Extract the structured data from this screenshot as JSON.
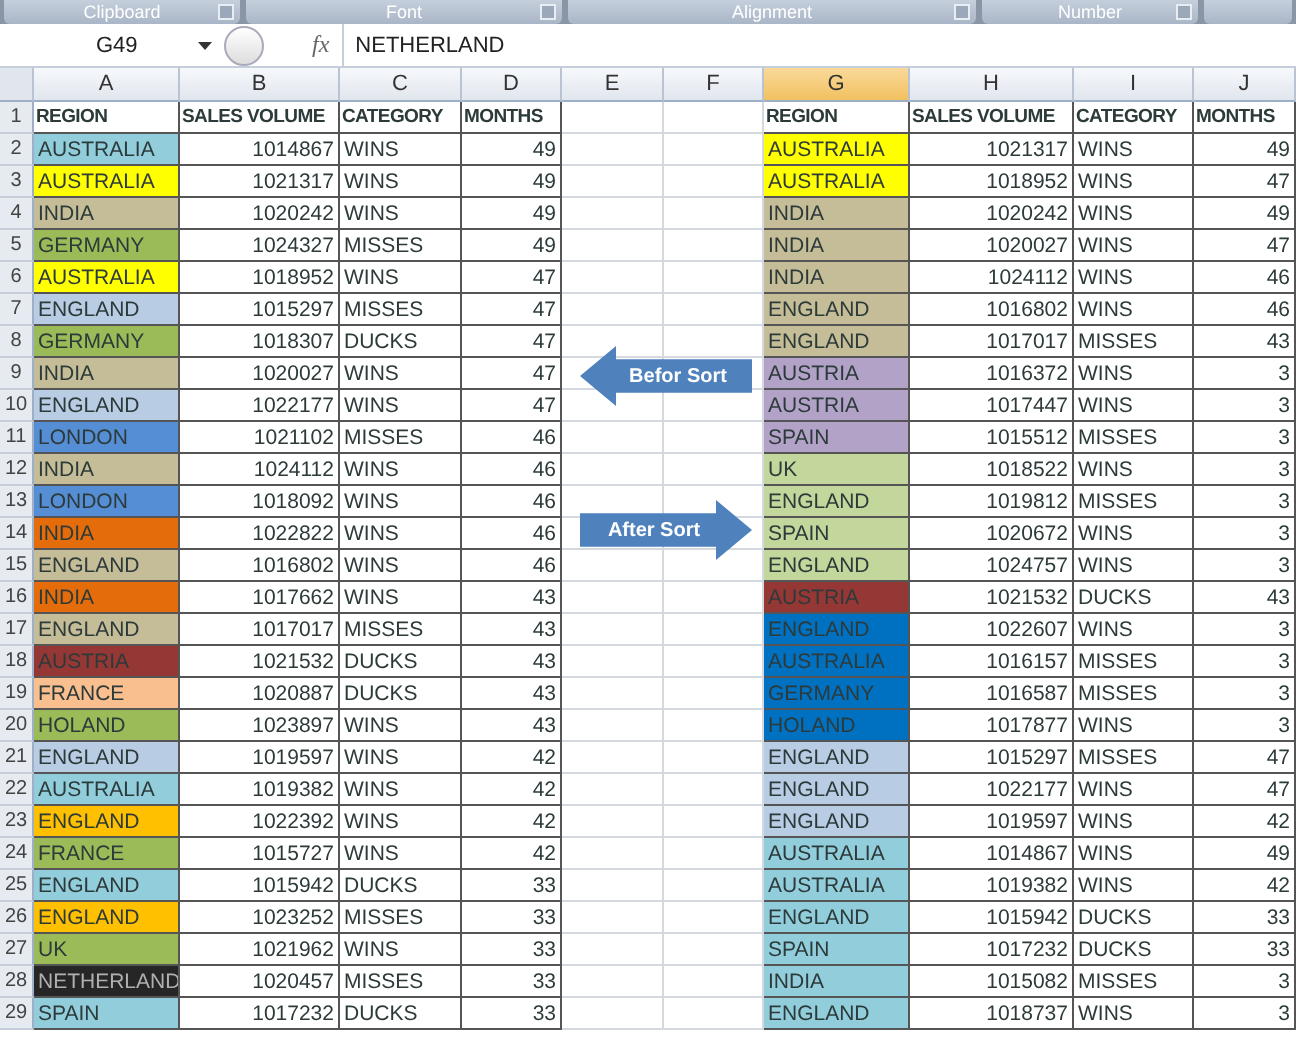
{
  "ribbon_groups": [
    {
      "label": "Clipboard"
    },
    {
      "label": "Font"
    },
    {
      "label": "Alignment"
    },
    {
      "label": "Number"
    }
  ],
  "formula_bar": {
    "name_box": "G49",
    "function_label": "fx",
    "formula": "NETHERLAND"
  },
  "columns": [
    {
      "label": "A",
      "selected": false
    },
    {
      "label": "B",
      "selected": false
    },
    {
      "label": "C",
      "selected": false
    },
    {
      "label": "D",
      "selected": false
    },
    {
      "label": "E",
      "selected": false
    },
    {
      "label": "F",
      "selected": false
    },
    {
      "label": "G",
      "selected": true
    },
    {
      "label": "H",
      "selected": false
    },
    {
      "label": "I",
      "selected": false
    },
    {
      "label": "J",
      "selected": false
    }
  ],
  "header_row": {
    "number": "1",
    "left": [
      "REGION",
      "SALES VOLUME",
      "CATEGORY",
      "MONTHS"
    ],
    "right": [
      "REGION",
      "SALES VOLUME",
      "CATEGORY",
      "MONTHS"
    ]
  },
  "rows": [
    {
      "number": "2",
      "left": {
        "region": "AUSTRALIA",
        "color": "#92cddc",
        "sales": "1014867",
        "category": "WINS",
        "months": "49"
      },
      "right": {
        "region": "AUSTRALIA",
        "color": "#ffff00",
        "sales": "1021317",
        "category": "WINS",
        "months": "49"
      }
    },
    {
      "number": "3",
      "left": {
        "region": "AUSTRALIA",
        "color": "#ffff00",
        "sales": "1021317",
        "category": "WINS",
        "months": "49"
      },
      "right": {
        "region": "AUSTRALIA",
        "color": "#ffff00",
        "sales": "1018952",
        "category": "WINS",
        "months": "47"
      }
    },
    {
      "number": "4",
      "left": {
        "region": "INDIA",
        "color": "#c4bd97",
        "sales": "1020242",
        "category": "WINS",
        "months": "49"
      },
      "right": {
        "region": "INDIA",
        "color": "#c4bd97",
        "sales": "1020242",
        "category": "WINS",
        "months": "49"
      }
    },
    {
      "number": "5",
      "left": {
        "region": "GERMANY",
        "color": "#9bbb59",
        "sales": "1024327",
        "category": "MISSES",
        "months": "49"
      },
      "right": {
        "region": "INDIA",
        "color": "#c4bd97",
        "sales": "1020027",
        "category": "WINS",
        "months": "47"
      }
    },
    {
      "number": "6",
      "left": {
        "region": "AUSTRALIA",
        "color": "#ffff00",
        "sales": "1018952",
        "category": "WINS",
        "months": "47"
      },
      "right": {
        "region": "INDIA",
        "color": "#c4bd97",
        "sales": "1024112",
        "category": "WINS",
        "months": "46"
      }
    },
    {
      "number": "7",
      "left": {
        "region": "ENGLAND",
        "color": "#b8cce4",
        "sales": "1015297",
        "category": "MISSES",
        "months": "47"
      },
      "right": {
        "region": "ENGLAND",
        "color": "#c4bd97",
        "sales": "1016802",
        "category": "WINS",
        "months": "46"
      }
    },
    {
      "number": "8",
      "left": {
        "region": "GERMANY",
        "color": "#9bbb59",
        "sales": "1018307",
        "category": "DUCKS",
        "months": "47"
      },
      "right": {
        "region": "ENGLAND",
        "color": "#c4bd97",
        "sales": "1017017",
        "category": "MISSES",
        "months": "43"
      }
    },
    {
      "number": "9",
      "left": {
        "region": "INDIA",
        "color": "#c4bd97",
        "sales": "1020027",
        "category": "WINS",
        "months": "47"
      },
      "right": {
        "region": "AUSTRIA",
        "color": "#b2a2c7",
        "sales": "1016372",
        "category": "WINS",
        "months": "3"
      }
    },
    {
      "number": "10",
      "left": {
        "region": "ENGLAND",
        "color": "#b8cce4",
        "sales": "1022177",
        "category": "WINS",
        "months": "47"
      },
      "right": {
        "region": "AUSTRIA",
        "color": "#b2a2c7",
        "sales": "1017447",
        "category": "WINS",
        "months": "3"
      }
    },
    {
      "number": "11",
      "left": {
        "region": "LONDON",
        "color": "#558ed5",
        "sales": "1021102",
        "category": "MISSES",
        "months": "46"
      },
      "right": {
        "region": "SPAIN",
        "color": "#b2a2c7",
        "sales": "1015512",
        "category": "MISSES",
        "months": "3"
      }
    },
    {
      "number": "12",
      "left": {
        "region": "INDIA",
        "color": "#c4bd97",
        "sales": "1024112",
        "category": "WINS",
        "months": "46"
      },
      "right": {
        "region": "UK",
        "color": "#c3d69b",
        "sales": "1018522",
        "category": "WINS",
        "months": "3"
      }
    },
    {
      "number": "13",
      "left": {
        "region": "LONDON",
        "color": "#558ed5",
        "sales": "1018092",
        "category": "WINS",
        "months": "46"
      },
      "right": {
        "region": "ENGLAND",
        "color": "#c3d69b",
        "sales": "1019812",
        "category": "MISSES",
        "months": "3"
      }
    },
    {
      "number": "14",
      "left": {
        "region": "INDIA",
        "color": "#e46c0a",
        "sales": "1022822",
        "category": "WINS",
        "months": "46"
      },
      "right": {
        "region": "SPAIN",
        "color": "#c3d69b",
        "sales": "1020672",
        "category": "WINS",
        "months": "3"
      }
    },
    {
      "number": "15",
      "left": {
        "region": "ENGLAND",
        "color": "#c4bd97",
        "sales": "1016802",
        "category": "WINS",
        "months": "46"
      },
      "right": {
        "region": "ENGLAND",
        "color": "#c3d69b",
        "sales": "1024757",
        "category": "WINS",
        "months": "3"
      }
    },
    {
      "number": "16",
      "left": {
        "region": "INDIA",
        "color": "#e46c0a",
        "sales": "1017662",
        "category": "WINS",
        "months": "43"
      },
      "right": {
        "region": "AUSTRIA",
        "color": "#953735",
        "sales": "1021532",
        "category": "DUCKS",
        "months": "43"
      }
    },
    {
      "number": "17",
      "left": {
        "region": "ENGLAND",
        "color": "#c4bd97",
        "sales": "1017017",
        "category": "MISSES",
        "months": "43"
      },
      "right": {
        "region": "ENGLAND",
        "color": "#0070c0",
        "sales": "1022607",
        "category": "WINS",
        "months": "3"
      }
    },
    {
      "number": "18",
      "left": {
        "region": "AUSTRIA",
        "color": "#953735",
        "sales": "1021532",
        "category": "DUCKS",
        "months": "43"
      },
      "right": {
        "region": "AUSTRALIA",
        "color": "#0070c0",
        "sales": "1016157",
        "category": "MISSES",
        "months": "3"
      }
    },
    {
      "number": "19",
      "left": {
        "region": "FRANCE",
        "color": "#fabf8f",
        "sales": "1020887",
        "category": "DUCKS",
        "months": "43"
      },
      "right": {
        "region": "GERMANY",
        "color": "#0070c0",
        "sales": "1016587",
        "category": "MISSES",
        "months": "3"
      }
    },
    {
      "number": "20",
      "left": {
        "region": "HOLAND",
        "color": "#9bbb59",
        "sales": "1023897",
        "category": "WINS",
        "months": "43"
      },
      "right": {
        "region": "HOLAND",
        "color": "#0070c0",
        "sales": "1017877",
        "category": "WINS",
        "months": "3"
      }
    },
    {
      "number": "21",
      "left": {
        "region": "ENGLAND",
        "color": "#b8cce4",
        "sales": "1019597",
        "category": "WINS",
        "months": "42"
      },
      "right": {
        "region": "ENGLAND",
        "color": "#b8cce4",
        "sales": "1015297",
        "category": "MISSES",
        "months": "47"
      }
    },
    {
      "number": "22",
      "left": {
        "region": "AUSTRALIA",
        "color": "#92cddc",
        "sales": "1019382",
        "category": "WINS",
        "months": "42"
      },
      "right": {
        "region": "ENGLAND",
        "color": "#b8cce4",
        "sales": "1022177",
        "category": "WINS",
        "months": "47"
      }
    },
    {
      "number": "23",
      "left": {
        "region": "ENGLAND",
        "color": "#ffc000",
        "sales": "1022392",
        "category": "WINS",
        "months": "42"
      },
      "right": {
        "region": "ENGLAND",
        "color": "#b8cce4",
        "sales": "1019597",
        "category": "WINS",
        "months": "42"
      }
    },
    {
      "number": "24",
      "left": {
        "region": "FRANCE",
        "color": "#9bbb59",
        "sales": "1015727",
        "category": "WINS",
        "months": "42"
      },
      "right": {
        "region": "AUSTRALIA",
        "color": "#92cddc",
        "sales": "1014867",
        "category": "WINS",
        "months": "49"
      }
    },
    {
      "number": "25",
      "left": {
        "region": "ENGLAND",
        "color": "#92cddc",
        "sales": "1015942",
        "category": "DUCKS",
        "months": "33"
      },
      "right": {
        "region": "AUSTRALIA",
        "color": "#92cddc",
        "sales": "1019382",
        "category": "WINS",
        "months": "42"
      }
    },
    {
      "number": "26",
      "left": {
        "region": "ENGLAND",
        "color": "#ffc000",
        "sales": "1023252",
        "category": "MISSES",
        "months": "33"
      },
      "right": {
        "region": "ENGLAND",
        "color": "#92cddc",
        "sales": "1015942",
        "category": "DUCKS",
        "months": "33"
      }
    },
    {
      "number": "27",
      "left": {
        "region": "UK",
        "color": "#9bbb59",
        "sales": "1021962",
        "category": "WINS",
        "months": "33"
      },
      "right": {
        "region": "SPAIN",
        "color": "#92cddc",
        "sales": "1017232",
        "category": "DUCKS",
        "months": "33"
      }
    },
    {
      "number": "28",
      "left": {
        "region": "NETHERLAND",
        "color": "#262626",
        "sales": "1020457",
        "category": "MISSES",
        "months": "33"
      },
      "right": {
        "region": "INDIA",
        "color": "#92cddc",
        "sales": "1015082",
        "category": "MISSES",
        "months": "3"
      }
    },
    {
      "number": "29",
      "left": {
        "region": "SPAIN",
        "color": "#92cddc",
        "sales": "1017232",
        "category": "DUCKS",
        "months": "33"
      },
      "right": {
        "region": "ENGLAND",
        "color": "#92cddc",
        "sales": "1018737",
        "category": "WINS",
        "months": "3"
      }
    }
  ],
  "callouts": [
    {
      "label": "Befor Sort",
      "kind": "left"
    },
    {
      "label": "After Sort",
      "kind": "right"
    }
  ]
}
